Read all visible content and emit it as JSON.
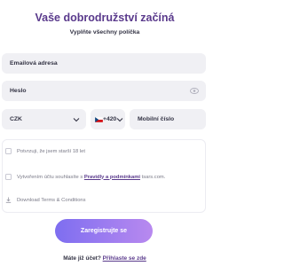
{
  "header": {
    "title": "Vaše dobrodružství začíná",
    "subtitle": "Vyplňte všechny políčka"
  },
  "form": {
    "email_placeholder": "Emailová adresa",
    "password_placeholder": "Heslo",
    "currency_value": "CZK",
    "dial_code": "+420",
    "phone_placeholder": "Mobilní číslo"
  },
  "terms": {
    "age_confirm": "Potvrzuji, že jsem starší 18 let",
    "accept_prefix": "Vytvořením účtu souhlasíte s",
    "accept_link": "Pravidly a podmínkami",
    "accept_suffix": "tsars.com.",
    "download": "Download Terms & Conditions"
  },
  "cta": {
    "register_label": "Zaregistrujte se"
  },
  "footer": {
    "have_account": "Máte již účet?",
    "login_link": "Přihlaste se zde"
  },
  "colors": {
    "accent": "#5a3a8c",
    "button_start": "#7e6ef0",
    "button_end": "#b889ef",
    "field_bg": "#f0f0f4"
  },
  "icons": {
    "password_toggle": "eye-icon",
    "dropdown": "chevron-down-icon",
    "flag": "czech-flag-icon",
    "download": "download-icon"
  }
}
